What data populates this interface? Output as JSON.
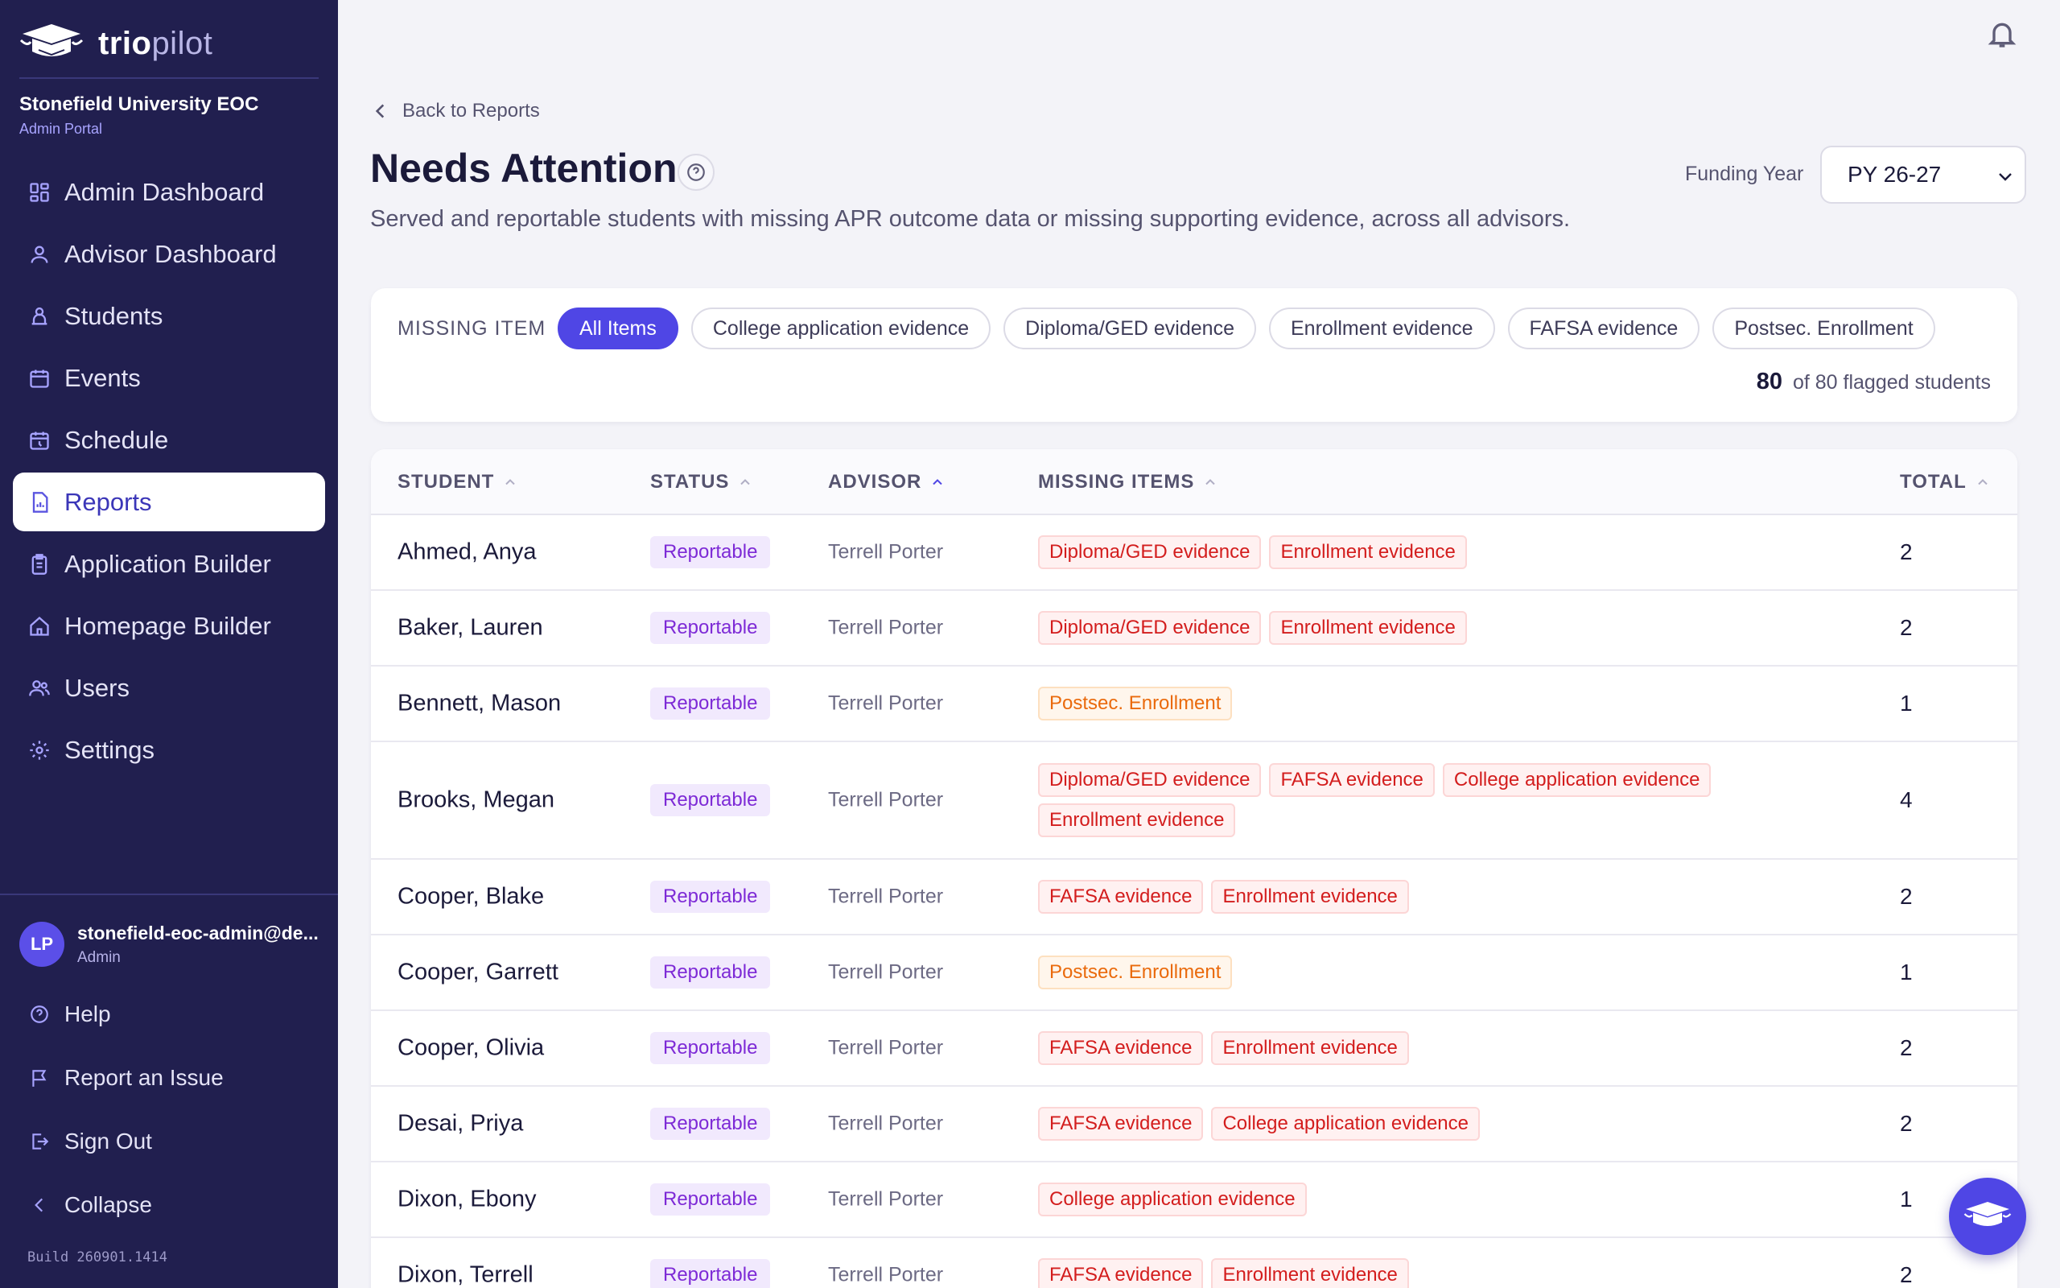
{
  "brand": {
    "name_bold": "trio",
    "name_light": "pilot"
  },
  "org": {
    "name": "Stonefield University EOC",
    "portal": "Admin Portal"
  },
  "nav": [
    {
      "label": "Admin Dashboard",
      "icon": "dashboard-icon",
      "active": false
    },
    {
      "label": "Advisor Dashboard",
      "icon": "user-icon",
      "active": false
    },
    {
      "label": "Students",
      "icon": "students-icon",
      "active": false
    },
    {
      "label": "Events",
      "icon": "calendar-icon",
      "active": false
    },
    {
      "label": "Schedule",
      "icon": "schedule-icon",
      "active": false
    },
    {
      "label": "Reports",
      "icon": "report-icon",
      "active": true
    },
    {
      "label": "Application Builder",
      "icon": "clipboard-icon",
      "active": false
    },
    {
      "label": "Homepage Builder",
      "icon": "home-icon",
      "active": false
    },
    {
      "label": "Users",
      "icon": "users-icon",
      "active": false
    },
    {
      "label": "Settings",
      "icon": "gear-icon",
      "active": false
    }
  ],
  "user": {
    "initials": "LP",
    "email": "stonefield-eoc-admin@de...",
    "role": "Admin"
  },
  "footer_nav": [
    {
      "label": "Help",
      "icon": "help-icon"
    },
    {
      "label": "Report an Issue",
      "icon": "flag-icon"
    },
    {
      "label": "Sign Out",
      "icon": "sign-out-icon"
    },
    {
      "label": "Collapse",
      "icon": "chevron-left-icon"
    }
  ],
  "build": "Build 260901.1414",
  "header": {
    "back_label": "Back to Reports",
    "title": "Needs Attention",
    "subtitle": "Served and reportable students with missing APR outcome data or missing supporting evidence, across all advisors.",
    "funding_year_label": "Funding Year",
    "funding_year_value": "PY 26-27"
  },
  "filters": {
    "label": "MISSING ITEM",
    "chips": [
      {
        "label": "All Items",
        "active": true
      },
      {
        "label": "College application evidence",
        "active": false
      },
      {
        "label": "Diploma/GED evidence",
        "active": false
      },
      {
        "label": "Enrollment evidence",
        "active": false
      },
      {
        "label": "FAFSA evidence",
        "active": false
      },
      {
        "label": "Postsec. Enrollment",
        "active": false
      }
    ],
    "count_shown": "80",
    "count_text": "of 80 flagged students"
  },
  "table": {
    "columns": [
      "STUDENT",
      "STATUS",
      "ADVISOR",
      "MISSING ITEMS",
      "TOTAL"
    ],
    "rows": [
      {
        "student": "Ahmed, Anya",
        "status": "Reportable",
        "advisor": "Terrell Porter",
        "missing": [
          "Diploma/GED evidence",
          "Enrollment evidence"
        ],
        "total": "2"
      },
      {
        "student": "Baker, Lauren",
        "status": "Reportable",
        "advisor": "Terrell Porter",
        "missing": [
          "Diploma/GED evidence",
          "Enrollment evidence"
        ],
        "total": "2"
      },
      {
        "student": "Bennett, Mason",
        "status": "Reportable",
        "advisor": "Terrell Porter",
        "missing": [
          "Postsec. Enrollment"
        ],
        "total": "1"
      },
      {
        "student": "Brooks, Megan",
        "status": "Reportable",
        "advisor": "Terrell Porter",
        "missing": [
          "Diploma/GED evidence",
          "FAFSA evidence",
          "College application evidence",
          "Enrollment evidence"
        ],
        "total": "4"
      },
      {
        "student": "Cooper, Blake",
        "status": "Reportable",
        "advisor": "Terrell Porter",
        "missing": [
          "FAFSA evidence",
          "Enrollment evidence"
        ],
        "total": "2"
      },
      {
        "student": "Cooper, Garrett",
        "status": "Reportable",
        "advisor": "Terrell Porter",
        "missing": [
          "Postsec. Enrollment"
        ],
        "total": "1"
      },
      {
        "student": "Cooper, Olivia",
        "status": "Reportable",
        "advisor": "Terrell Porter",
        "missing": [
          "FAFSA evidence",
          "Enrollment evidence"
        ],
        "total": "2"
      },
      {
        "student": "Desai, Priya",
        "status": "Reportable",
        "advisor": "Terrell Porter",
        "missing": [
          "FAFSA evidence",
          "College application evidence"
        ],
        "total": "2"
      },
      {
        "student": "Dixon, Ebony",
        "status": "Reportable",
        "advisor": "Terrell Porter",
        "missing": [
          "College application evidence"
        ],
        "total": "1"
      },
      {
        "student": "Dixon, Terrell",
        "status": "Reportable",
        "advisor": "Terrell Porter",
        "missing": [
          "FAFSA evidence",
          "Enrollment evidence"
        ],
        "total": "2"
      }
    ]
  },
  "colors": {
    "sidebar": "#211f4f",
    "accent": "#4f46e5",
    "missing_tag": "#d31d1d",
    "postsec_tag": "#ea6a0c",
    "status_tag": "#7d2ad6"
  }
}
